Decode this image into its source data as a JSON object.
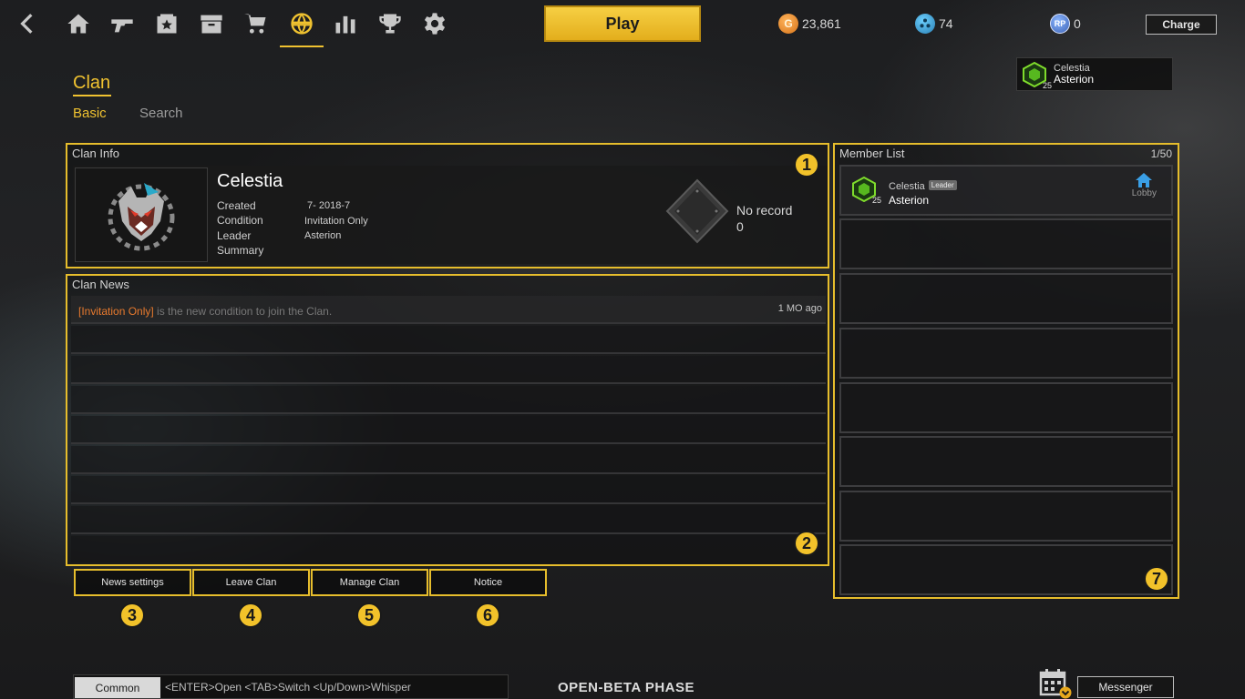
{
  "nav": {
    "items": [
      {
        "name": "home-icon"
      },
      {
        "name": "weapon-icon"
      },
      {
        "name": "storage-icon"
      },
      {
        "name": "inventory-icon"
      },
      {
        "name": "shop-icon"
      },
      {
        "name": "clan-globe-icon",
        "active": true
      },
      {
        "name": "stats-icon"
      },
      {
        "name": "trophy-icon"
      },
      {
        "name": "settings-icon"
      }
    ],
    "play_label": "Play",
    "currencies": {
      "gold": "23,861",
      "gold_symbol": "G",
      "crystal": "74",
      "rp": "0",
      "rp_symbol": "RP"
    },
    "charge_label": "Charge"
  },
  "profile": {
    "clan": "Celestia",
    "name": "Asterion",
    "rank": "25"
  },
  "header": {
    "title": "Clan",
    "tabs": [
      {
        "label": "Basic",
        "active": true
      },
      {
        "label": "Search",
        "active": false
      }
    ]
  },
  "clan_info": {
    "panel_title": "Clan Info",
    "name": "Celestia",
    "labels": {
      "created": "Created",
      "condition": "Condition",
      "leader": "Leader",
      "summary": "Summary"
    },
    "values": {
      "created": "7- 2018-7",
      "condition": "Invitation Only",
      "leader": "Asterion",
      "summary": ""
    },
    "record_label": "No record",
    "record_value": "0",
    "callout": "1"
  },
  "clan_news": {
    "panel_title": "Clan News",
    "items": [
      {
        "tag": "[Invitation Only]",
        "text": " is the new condition to join the Clan.",
        "time": "1 MO ago"
      }
    ],
    "callout": "2"
  },
  "actions": [
    {
      "label": "News settings",
      "callout": "3"
    },
    {
      "label": "Leave Clan",
      "callout": "4"
    },
    {
      "label": "Manage Clan",
      "callout": "5"
    },
    {
      "label": "Notice",
      "callout": "6"
    }
  ],
  "member_list": {
    "panel_title": "Member List",
    "count": "1/50",
    "members": [
      {
        "clan": "Celestia",
        "name": "Asterion",
        "rank": "25",
        "badge": "Leader",
        "status": "Lobby"
      }
    ],
    "callout": "7"
  },
  "bottom": {
    "chat_tab": "Common",
    "chat_hint": "<ENTER>Open <TAB>Switch <Up/Down>Whisper",
    "phase": "OPEN-BETA PHASE",
    "messenger_label": "Messenger"
  },
  "colors": {
    "accent": "#f0c230",
    "news_tag": "#e87a2e",
    "status_lobby": "#3a9fe6"
  }
}
